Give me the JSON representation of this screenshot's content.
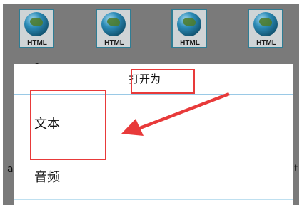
{
  "files": [
    {
      "tag": "HTML",
      "caption": "a"
    },
    {
      "tag": "HTML",
      "caption": ""
    },
    {
      "tag": "HTML",
      "caption": ""
    },
    {
      "tag": "HTML",
      "caption": ""
    }
  ],
  "sidebar_text": {
    "left": "a",
    "right": "t"
  },
  "dialog": {
    "title": "打开为",
    "options": [
      {
        "label": "文本"
      },
      {
        "label": "音频"
      }
    ]
  },
  "annotation_color": "#e83a3a"
}
